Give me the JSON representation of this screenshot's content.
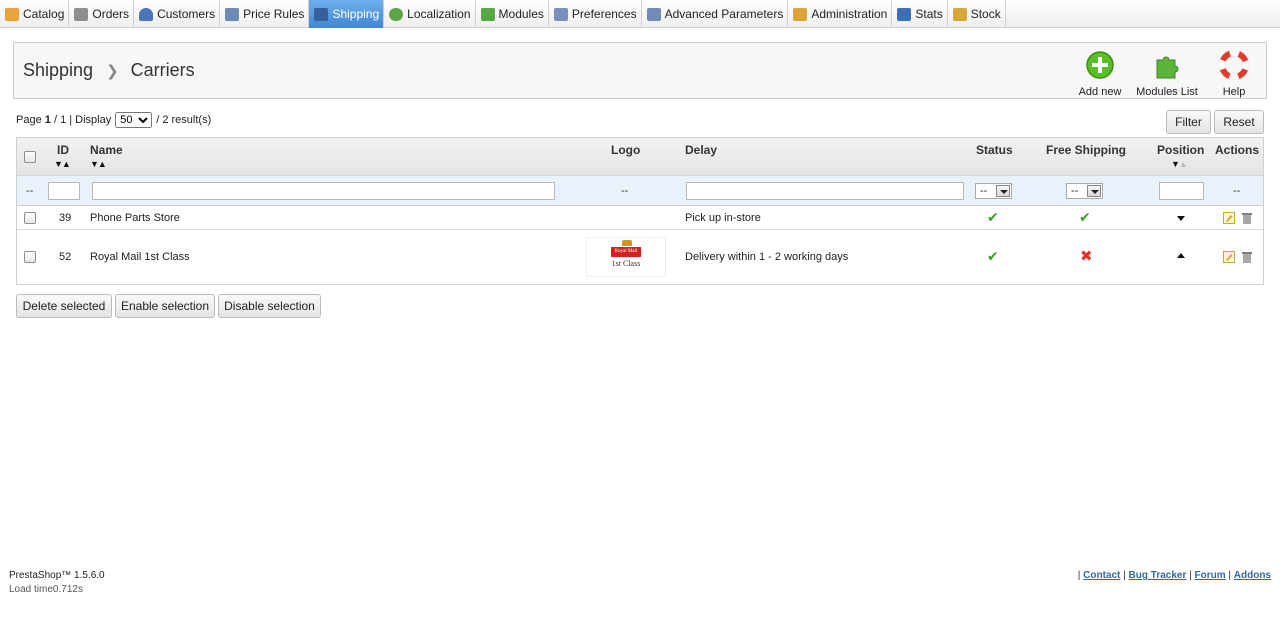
{
  "menu": [
    {
      "label": "Catalog",
      "icon": "folder-icon",
      "color": "#e8a43b"
    },
    {
      "label": "Orders",
      "icon": "cart-icon",
      "color": "#8e8e8e"
    },
    {
      "label": "Customers",
      "icon": "user-icon",
      "color": "#4d73b8"
    },
    {
      "label": "Price Rules",
      "icon": "price-tag-icon",
      "color": "#6c8db5"
    },
    {
      "label": "Shipping",
      "icon": "truck-icon",
      "color": "#365f9c",
      "active": true
    },
    {
      "label": "Localization",
      "icon": "globe-icon",
      "color": "#5ca448"
    },
    {
      "label": "Modules",
      "icon": "puzzle-icon",
      "color": "#58a747"
    },
    {
      "label": "Preferences",
      "icon": "preferences-icon",
      "color": "#7b8fbd"
    },
    {
      "label": "Advanced Parameters",
      "icon": "wrench-icon",
      "color": "#6f8bb6"
    },
    {
      "label": "Administration",
      "icon": "key-icon",
      "color": "#d9a537"
    },
    {
      "label": "Stats",
      "icon": "bar-chart-icon",
      "color": "#3d6fb4"
    },
    {
      "label": "Stock",
      "icon": "stock-icon",
      "color": "#d8a73a"
    }
  ],
  "breadcrumb": {
    "section": "Shipping",
    "page": "Carriers"
  },
  "toolbar": {
    "add_new": "Add new",
    "modules_list": "Modules List",
    "help": "Help"
  },
  "pagination": {
    "page_label": "Page",
    "current_page": "1",
    "total_pages": "/ 1",
    "display_label": "| Display",
    "per_page": "50",
    "results": "/ 2 result(s)"
  },
  "filter_buttons": {
    "filter": "Filter",
    "reset": "Reset"
  },
  "columns": {
    "id": "ID",
    "name": "Name",
    "logo": "Logo",
    "delay": "Delay",
    "status": "Status",
    "free_shipping": "Free Shipping",
    "position": "Position",
    "actions": "Actions"
  },
  "filters": {
    "empty_dash": "--",
    "status_value": "--",
    "free_shipping_value": "--"
  },
  "rows": [
    {
      "id": "39",
      "name": "Phone Parts Store",
      "logo": "",
      "delay": "Pick up in-store",
      "status": true,
      "free_shipping": true,
      "position": "down"
    },
    {
      "id": "52",
      "name": "Royal Mail 1st Class",
      "logo": "royal-mail-logo",
      "logo_text": "Royal Mail",
      "logo_sub": "1st Class",
      "delay": "Delivery within 1 - 2 working days",
      "status": true,
      "free_shipping": false,
      "position": "up"
    }
  ],
  "bulk": {
    "delete": "Delete selected",
    "enable": "Enable selection",
    "disable": "Disable selection"
  },
  "footer": {
    "version": "PrestaShop™ 1.5.6.0",
    "load_time": "Load time0.712s",
    "links": [
      "Contact",
      "Bug Tracker",
      "Forum",
      "Addons"
    ]
  },
  "colors": {
    "active_tab": "#3f87d4",
    "check": "#3c9d2a",
    "cross": "#e23030",
    "link": "#2d6aa8"
  }
}
